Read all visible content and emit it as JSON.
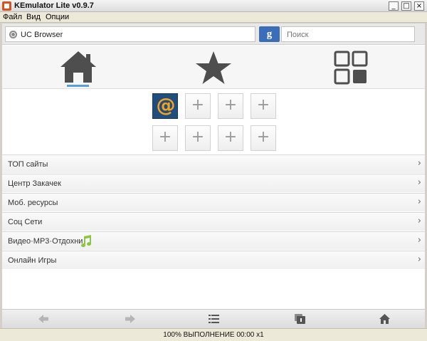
{
  "window": {
    "title": "KEmulator Lite v0.9.7",
    "controls": {
      "minimize": "_",
      "maximize": "□",
      "close": "×"
    }
  },
  "menu": {
    "items": [
      "Файл",
      "Вид",
      "Опции"
    ]
  },
  "browser": {
    "url": "UC Browser",
    "search_engine_badge": "g",
    "search_placeholder": "Поиск",
    "tabs": [
      {
        "name": "home",
        "icon": "house-icon",
        "active": true
      },
      {
        "name": "favorites",
        "icon": "star-icon",
        "active": false
      },
      {
        "name": "apps",
        "icon": "grid-icon",
        "active": false
      }
    ],
    "speed_dial": {
      "tiles": [
        {
          "type": "mail",
          "label": "@"
        },
        {
          "type": "add",
          "label": "+"
        },
        {
          "type": "add",
          "label": "+"
        },
        {
          "type": "add",
          "label": "+"
        },
        {
          "type": "add",
          "label": "+"
        },
        {
          "type": "add",
          "label": "+"
        },
        {
          "type": "add",
          "label": "+"
        },
        {
          "type": "add",
          "label": "+"
        }
      ]
    },
    "categories": [
      {
        "label": "ТОП сайты",
        "chevron": "›"
      },
      {
        "label": "Центр Закачек",
        "chevron": "›"
      },
      {
        "label": "Моб. ресурсы",
        "chevron": "›"
      },
      {
        "label": "Соц Сети",
        "chevron": "›"
      },
      {
        "label": "Видео·MP3·Отдохни",
        "chevron": "›",
        "icon": "music-note-icon"
      },
      {
        "label": "Онлайн Игры",
        "chevron": "›"
      }
    ],
    "bottom_nav": [
      "back-arrow-icon",
      "forward-arrow-icon",
      "menu-list-icon",
      "windows-icon",
      "home-icon"
    ]
  },
  "status": {
    "text": "100% ВЫПОЛНЕНИЕ 00:00 x1"
  },
  "colors": {
    "accent": "#5aa0d6",
    "google_blue": "#3c6db8",
    "mail_orange": "#f7a21b",
    "mail_blue": "#1f4e7d",
    "music_green": "#8cc63f"
  }
}
